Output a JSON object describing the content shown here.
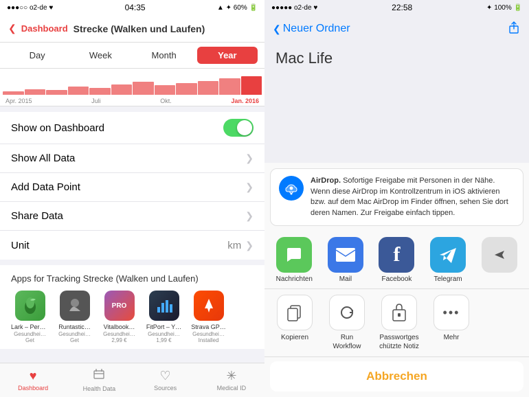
{
  "left": {
    "statusBar": {
      "carrier": "●●●○○ o2-de ♥",
      "time": "04:35",
      "battery": "60%",
      "signal": "▲ ✦ 60%"
    },
    "nav": {
      "back": "Dashboard",
      "title": "Strecke (Walken und Laufen)"
    },
    "periodTabs": [
      "Day",
      "Week",
      "Month",
      "Year"
    ],
    "activeTab": "Year",
    "chartLabels": [
      "Apr. 2015",
      "Juli",
      "Okt.",
      "Jan. 2016"
    ],
    "settings": [
      {
        "id": "show-on-dashboard",
        "label": "Show on Dashboard",
        "type": "toggle",
        "value": true
      },
      {
        "id": "show-all-data",
        "label": "Show All Data",
        "type": "chevron"
      },
      {
        "id": "add-data-point",
        "label": "Add Data Point",
        "type": "chevron"
      },
      {
        "id": "share-data",
        "label": "Share Data",
        "type": "chevron"
      },
      {
        "id": "unit",
        "label": "Unit",
        "type": "chevron",
        "value": "km"
      }
    ],
    "appsSection": {
      "title": "Apps for Tracking Strecke (Walken und Laufen)",
      "apps": [
        {
          "name": "Lark – Pers…",
          "sub": "Gesundhei…",
          "price": "Get",
          "color": "icon-lark",
          "icon": "🌿"
        },
        {
          "name": "Runtastic…",
          "sub": "Gesundhei…",
          "price": "Get",
          "color": "icon-runtastic",
          "icon": "👤"
        },
        {
          "name": "Vitalbook…",
          "sub": "Gesundhei…",
          "price": "2,99 €",
          "color": "icon-vital",
          "icon": "📊"
        },
        {
          "name": "FitPort – Y…",
          "sub": "Gesundhei…",
          "price": "1,99 €",
          "color": "icon-fitport",
          "icon": "📈"
        },
        {
          "name": "Strava GP…",
          "sub": "Gesundhei…",
          "price": "Installed",
          "color": "icon-strava",
          "icon": "⚡"
        }
      ]
    },
    "tabBar": [
      {
        "id": "dashboard",
        "label": "Dashboard",
        "icon": "❤",
        "active": true
      },
      {
        "id": "health-data",
        "label": "Health Data",
        "icon": "📋",
        "active": false
      },
      {
        "id": "sources",
        "label": "Sources",
        "icon": "♡",
        "active": false
      },
      {
        "id": "medical-id",
        "label": "Medical ID",
        "icon": "✳",
        "active": false
      }
    ]
  },
  "right": {
    "statusBar": {
      "carrier": "●●●●● o2-de ♥",
      "time": "22:58",
      "battery": "100%"
    },
    "nav": {
      "back": "Neuer Ordner",
      "shareIcon": "⬆"
    },
    "folderName": "Mac Life",
    "shareSheet": {
      "airdrop": {
        "title": "AirDrop.",
        "description": "Sofortige Freigabe mit Personen in der Nähe. Wenn diese AirDrop im Kontrollzentrum in iOS aktivieren bzw. auf dem Mac AirDrop im Finder öffnen, sehen Sie dort deren Namen. Zur Freigabe einfach tippen."
      },
      "apps": [
        {
          "name": "Nachrichten",
          "color": "icon-messages",
          "icon": "💬"
        },
        {
          "name": "Mail",
          "color": "icon-mail",
          "icon": "✉"
        },
        {
          "name": "Facebook",
          "color": "icon-fb",
          "icon": "f"
        },
        {
          "name": "Telegram",
          "color": "icon-telegram",
          "icon": "✈"
        }
      ],
      "actions": [
        {
          "name": "Kopieren",
          "icon": "📄"
        },
        {
          "name": "Run\nWorkflow",
          "icon": "↻"
        },
        {
          "name": "Passwortges\nchützte Notiz",
          "icon": "🔒"
        },
        {
          "name": "Mehr",
          "icon": "•••"
        }
      ],
      "cancelLabel": "Abbrechen"
    }
  }
}
